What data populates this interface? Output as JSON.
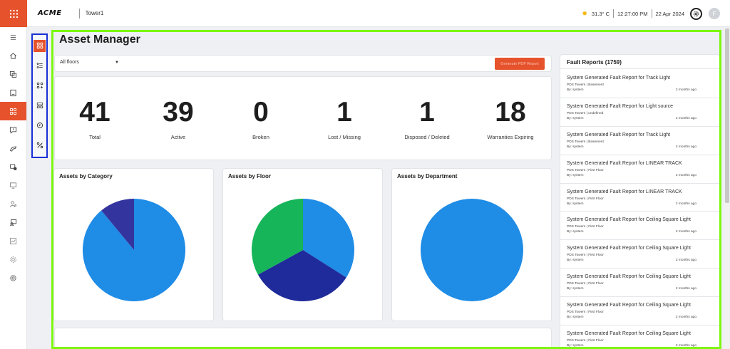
{
  "app": {
    "logo": "ACME",
    "site": "Tower1"
  },
  "header": {
    "temperature": "31.3° C",
    "time": "12:27:00 PM",
    "date": "22 Apr 2024",
    "avatar_initial": "F"
  },
  "nav": {
    "items": [
      {
        "name": "menu-icon",
        "active": false
      },
      {
        "name": "home-icon",
        "active": false
      },
      {
        "name": "copy-icon",
        "active": false
      },
      {
        "name": "book-icon",
        "active": false
      },
      {
        "name": "asset-manager-icon",
        "active": true
      },
      {
        "name": "fault-report-icon",
        "active": false
      },
      {
        "name": "tools-icon",
        "active": false
      },
      {
        "name": "visitor-icon",
        "active": false
      },
      {
        "name": "monitor-icon",
        "active": false
      },
      {
        "name": "users-icon",
        "active": false
      },
      {
        "name": "booking-icon",
        "active": false
      },
      {
        "name": "chart-icon",
        "active": false
      },
      {
        "name": "settings-icon",
        "active": false
      },
      {
        "name": "support-icon",
        "active": false
      }
    ]
  },
  "subnav": [
    "asset-overview-icon",
    "asset-list-icon",
    "asset-add-icon",
    "asset-category-icon",
    "asset-maintenance-icon",
    "asset-tools-icon"
  ],
  "page": {
    "title": "Asset Manager"
  },
  "filter": {
    "floor": "All floors",
    "pdf_button": "Generate PDF Report"
  },
  "stats": [
    {
      "value": "41",
      "label": "Total"
    },
    {
      "value": "39",
      "label": "Active"
    },
    {
      "value": "0",
      "label": "Broken"
    },
    {
      "value": "1",
      "label": "Lost / Missing"
    },
    {
      "value": "1",
      "label": "Disposed / Deleted"
    },
    {
      "value": "18",
      "label": "Warranties Expiring"
    }
  ],
  "charts": {
    "category": {
      "title": "Assets by Category"
    },
    "floor": {
      "title": "Assets by Floor"
    },
    "department": {
      "title": "Assets by Department"
    }
  },
  "chart_data": [
    {
      "type": "pie",
      "title": "Assets by Category",
      "values": [
        0.89,
        0.11
      ],
      "colors": [
        "#1f8ce6",
        "#34349e"
      ]
    },
    {
      "type": "pie",
      "title": "Assets by Floor",
      "values": [
        0.34,
        0.33,
        0.33
      ],
      "colors": [
        "#1f8ce6",
        "#1f2b9a",
        "#16b55a"
      ]
    },
    {
      "type": "pie",
      "title": "Assets by Department",
      "values": [
        1.0
      ],
      "colors": [
        "#1f8ce6"
      ]
    }
  ],
  "faults": {
    "title": "Fault Reports (1759)",
    "items": [
      {
        "title": "System Generated Fault Report for Track Light",
        "location": "PDS Towers | Basement",
        "by": "By: system",
        "ago": "2 months ago"
      },
      {
        "title": "System Generated Fault Report for Light source",
        "location": "PDS Towers | undefined",
        "by": "By: system",
        "ago": "2 months ago"
      },
      {
        "title": "System Generated Fault Report for Track Light",
        "location": "PDS Towers | Basement",
        "by": "By: system",
        "ago": "2 months ago"
      },
      {
        "title": "System Generated Fault Report for LINEAR TRACK",
        "location": "PDS Towers | First Floor",
        "by": "By: system",
        "ago": "2 months ago"
      },
      {
        "title": "System Generated Fault Report for LINEAR TRACK",
        "location": "PDS Towers | First Floor",
        "by": "By: system",
        "ago": "2 months ago"
      },
      {
        "title": "System Generated Fault Report for Ceiling Square Light",
        "location": "PDS Towers | First Floor",
        "by": "By: system",
        "ago": "2 months ago"
      },
      {
        "title": "System Generated Fault Report for Ceiling Square Light",
        "location": "PDS Towers | First Floor",
        "by": "By: system",
        "ago": "2 months ago"
      },
      {
        "title": "System Generated Fault Report for Ceiling Square Light",
        "location": "PDS Towers | First Floor",
        "by": "By: system",
        "ago": "2 months ago"
      },
      {
        "title": "System Generated Fault Report for Ceiling Square Light",
        "location": "PDS Towers | First Floor",
        "by": "By: system",
        "ago": "2 months ago"
      },
      {
        "title": "System Generated Fault Report for Ceiling Square Light",
        "location": "PDS Towers | First Floor",
        "by": "By: system",
        "ago": "2 months ago"
      }
    ]
  },
  "colors": {
    "accent": "#e5522c",
    "highlight": "#7cf70f",
    "subnav_border": "#1730d6"
  }
}
